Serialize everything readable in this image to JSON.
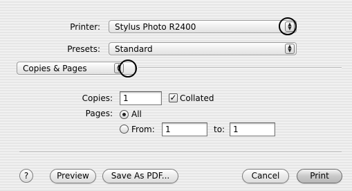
{
  "printer": {
    "label": "Printer:",
    "value": "Stylus Photo R2400"
  },
  "presets": {
    "label": "Presets:",
    "value": "Standard"
  },
  "panel_menu": {
    "value": "Copies & Pages"
  },
  "copies": {
    "label": "Copies:",
    "value": "1",
    "collated_label": "Collated",
    "collated_checked": true
  },
  "pages": {
    "label": "Pages:",
    "all_label": "All",
    "from_label": "From:",
    "from_value": "1",
    "to_label": "to:",
    "to_value": "1",
    "selected": "All"
  },
  "buttons": {
    "help": "?",
    "preview": "Preview",
    "save_pdf": "Save As PDF...",
    "cancel": "Cancel",
    "print": "Print"
  },
  "icons": {
    "stepper": "up-down-arrows-icon",
    "checkmark": "checkmark-icon",
    "highlight": "circle-highlight"
  }
}
